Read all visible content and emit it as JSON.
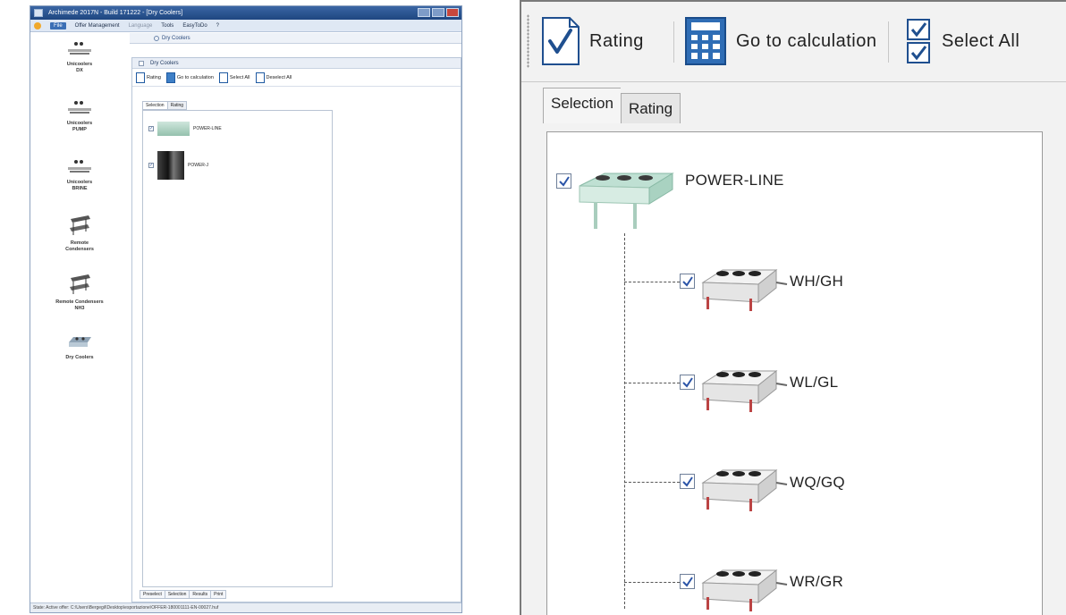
{
  "app": {
    "title": "Archimede 2017N - Build 171222 - [Dry Coolers]",
    "menu": [
      "File",
      "Offer Management",
      "Language",
      "Tools",
      "EasyToDo",
      "?"
    ],
    "sidebar": [
      {
        "label": "Unicoolers\nDX"
      },
      {
        "label": "Unicoolers\nPUMP"
      },
      {
        "label": "Unicoolers\nBRINE"
      },
      {
        "label": "Remote\nCondensers"
      },
      {
        "label": "Remote Condensers\nNH3"
      },
      {
        "label": "Dry Coolers"
      }
    ],
    "doc_tab": "Dry Coolers",
    "panel_title": "Dry Coolers",
    "toolbar": [
      "Rating",
      "Go to calculation",
      "Select All",
      "Deselect All"
    ],
    "tabs": [
      "Selection",
      "Rating"
    ],
    "tree": [
      {
        "label": "POWER-LINE",
        "checked": true
      },
      {
        "label": "POWER-J",
        "checked": true
      }
    ],
    "bottom_tabs": [
      "Preselect",
      "Selection",
      "Results",
      "Print"
    ],
    "status": "State:   Active offer: C:\\Users\\Bergegil\\Desktop\\esportazione\\OFFER-180001111-EN-00027.huf"
  },
  "zoom": {
    "toolbar": {
      "rating_label": "Rating",
      "calc_label": "Go to calculation",
      "select_all_label": "Select All"
    },
    "tabs": {
      "selection": "Selection",
      "rating": "Rating"
    },
    "root": {
      "label": "POWER-LINE",
      "checked": true
    },
    "children": [
      {
        "label": "WH/GH",
        "checked": true
      },
      {
        "label": "WL/GL",
        "checked": true
      },
      {
        "label": "WQ/GQ",
        "checked": true
      },
      {
        "label": "WR/GR",
        "checked": true
      }
    ]
  }
}
